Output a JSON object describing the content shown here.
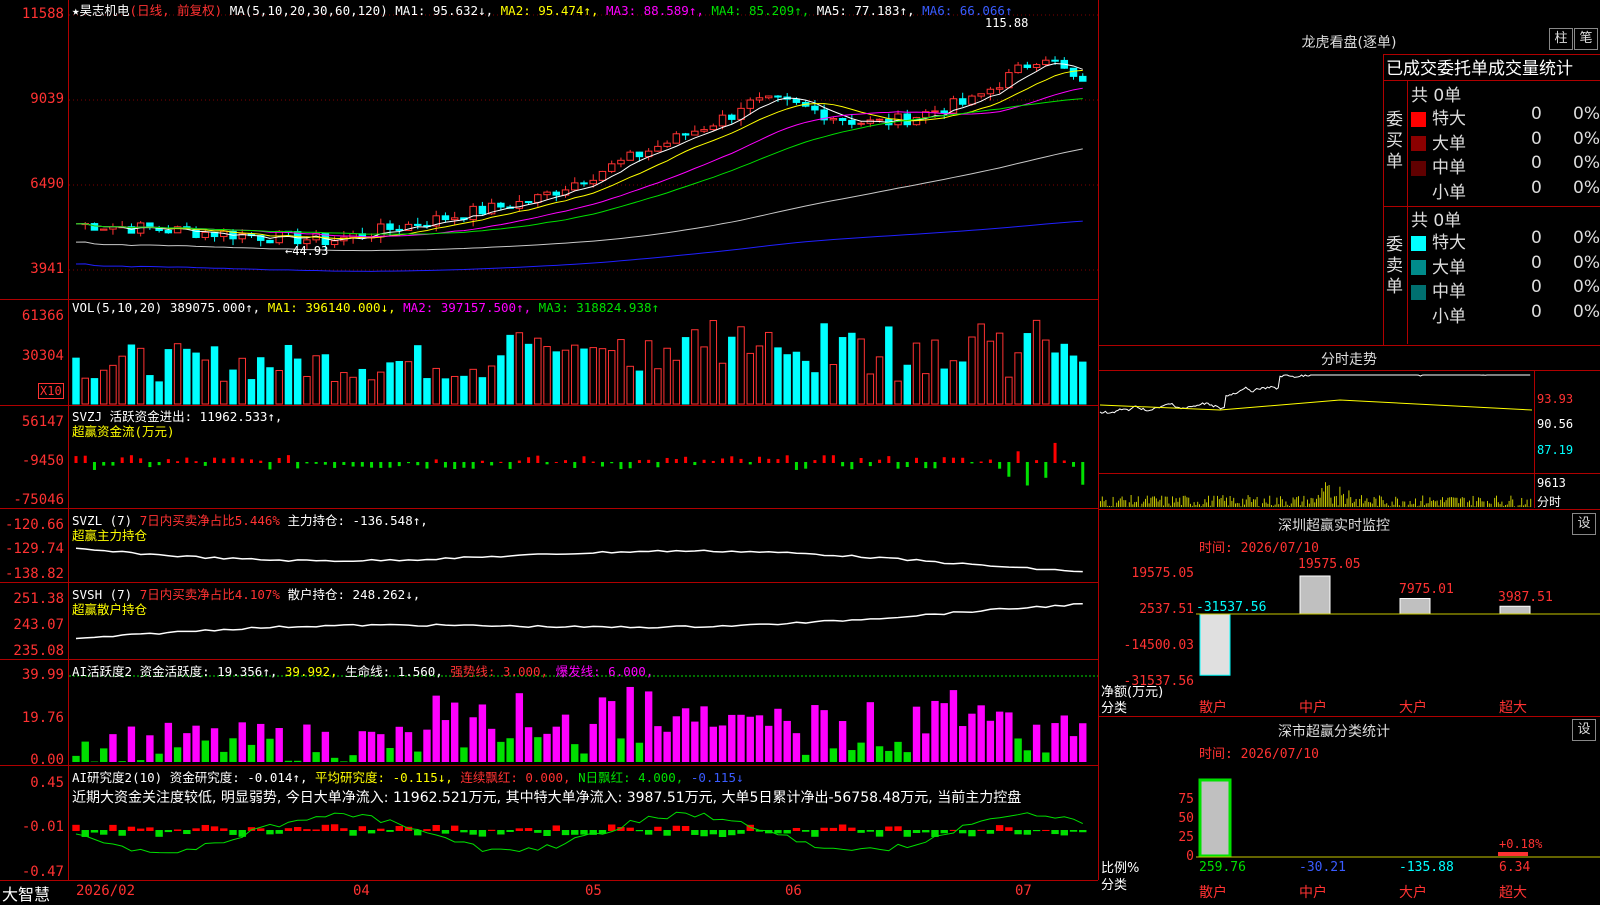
{
  "app": {
    "name": "大智慧"
  },
  "main_chart": {
    "title": "昊志机电",
    "mode": "(日线, 前复权)",
    "ma_spec": "MA(5,10,20,30,60,120)",
    "ma1": "MA1: 95.632↓,",
    "ma2": "MA2: 95.474↑,",
    "ma3": "MA3: 88.589↑,",
    "ma4": "MA4: 85.209↑,",
    "ma5": "MA5: 77.183↑,",
    "ma6": "MA6: 66.066↑",
    "y_ticks": [
      "11588",
      "9039",
      "6490",
      "3941"
    ],
    "high_label": "115.88",
    "low_label": "44.93",
    "colors": {
      "up": "#ff3232",
      "down": "#00ffff",
      "ma1": "#ffffff",
      "ma2": "#ffff00",
      "ma3": "#ff00ff",
      "ma4": "#00e000",
      "ma5": "#c8c8c8",
      "ma6": "#2020ff"
    }
  },
  "vol_panel": {
    "spec": "VOL(5,10,20)",
    "vol": "389075.000↑,",
    "ma1": "MA1: 396140.000↓,",
    "ma2": "MA2: 397157.500↑,",
    "ma3": "MA3: 318824.938↑",
    "y_ticks": [
      "61366",
      "30304"
    ],
    "unit": "X10"
  },
  "svzj_panel": {
    "line1": "SVZJ  活跃资金进出: 11962.533↑,",
    "line2": "超赢资金流(万元)",
    "y_ticks": [
      "56147",
      "-9450",
      "-75046"
    ]
  },
  "svzl_panel": {
    "name": "SVZL (7)",
    "ratio": "7日内买卖净占比5.446%",
    "holding": "主力持仓: -136.548↑,",
    "line2": "超赢主力持仓",
    "y_ticks": [
      "-120.66",
      "-129.74",
      "-138.82"
    ]
  },
  "svsh_panel": {
    "name": "SVSH (7)",
    "ratio": "7日内买卖净占比4.107%",
    "holding": "散户持仓: 248.262↓,",
    "line2": "超赢散户持仓",
    "y_ticks": [
      "251.38",
      "243.07",
      "235.08"
    ]
  },
  "ai_active_panel": {
    "name": "AI活跃度2",
    "fund": "资金活跃度: 19.356↑,",
    "v2": "39.992,",
    "life": "生命线: 1.560,",
    "strong": "强势线: 3.000,",
    "burst": "爆发线: 6.000,",
    "y_ticks": [
      "39.99",
      "19.76",
      "0.00"
    ]
  },
  "ai_research_panel": {
    "name": "AI研究度2(10)",
    "research": "资金研究度: -0.014↑,",
    "avg": "平均研究度: -0.115↓,",
    "cont": "连续飘红: 0.000,",
    "nday": "N日飘红: 4.000,",
    "v5": "-0.115↓",
    "comment": "近期大资金关注度较低, 明显弱势, 今日大单净流入: 11962.521万元, 其中特大单净流入: 3987.51万元, 大单5日累计净出-56758.48万元, 当前主力控盘",
    "y_ticks": [
      "0.45",
      "-0.01",
      "-0.47"
    ]
  },
  "x_axis": {
    "labels": [
      "2026/02",
      "04",
      "05",
      "06",
      "07"
    ]
  },
  "dragon_tiger": {
    "title": "龙虎看盘(逐单)",
    "btn_bar": "柱",
    "btn_pen": "笔",
    "header": "已成交委托单成交量统计",
    "buy_label": "委买单",
    "sell_label": "委卖单",
    "buy_total": "共 0单",
    "sell_total": "共 0单",
    "buy_rows": [
      {
        "name": "特大",
        "count": "0",
        "pct": "0%",
        "color": "#ff0000"
      },
      {
        "name": "大单",
        "count": "0",
        "pct": "0%",
        "color": "#8b0000"
      },
      {
        "name": "中单",
        "count": "0",
        "pct": "0%",
        "color": "#600000"
      },
      {
        "name": "小单",
        "count": "0",
        "pct": "0%",
        "color": ""
      }
    ],
    "sell_rows": [
      {
        "name": "特大",
        "count": "0",
        "pct": "0%",
        "color": "#00ffff"
      },
      {
        "name": "大单",
        "count": "0",
        "pct": "0%",
        "color": "#008b8b"
      },
      {
        "name": "中单",
        "count": "0",
        "pct": "0%",
        "color": "#007070"
      },
      {
        "name": "小单",
        "count": "0",
        "pct": "0%",
        "color": ""
      }
    ]
  },
  "intraday": {
    "title": "分时走势",
    "y_ticks": [
      "93.93",
      "90.56",
      "87.19"
    ],
    "vol_tick": "9613",
    "vol_label": "分时"
  },
  "sz_monitor": {
    "title": "深圳超赢实时监控",
    "btn": "设",
    "time": "时间: 2026/07/10",
    "y_ticks": [
      "19575.05",
      "2537.51",
      "-14500.03",
      "-31537.56"
    ],
    "side_label1": "净额(万元)",
    "side_label2": "分类",
    "categories": [
      "散户",
      "中户",
      "大户",
      "超大"
    ],
    "values": [
      -31537.56,
      19575.05,
      7975.01,
      3987.51
    ],
    "value_labels": [
      "-31537.56",
      "19575.05",
      "7975.01",
      "3987.51"
    ]
  },
  "sz_class": {
    "title": "深市超赢分类统计",
    "btn": "设",
    "time": "时间: 2026/07/10",
    "y_ticks": [
      "75",
      "50",
      "25",
      "0"
    ],
    "side_label1": "比例%",
    "side_label2": "分类",
    "categories": [
      "散户",
      "中户",
      "大户",
      "超大"
    ],
    "value_labels": [
      "259.76",
      "-30.21",
      "-135.88",
      "6.34"
    ],
    "pct_label": "+0.18%"
  }
}
